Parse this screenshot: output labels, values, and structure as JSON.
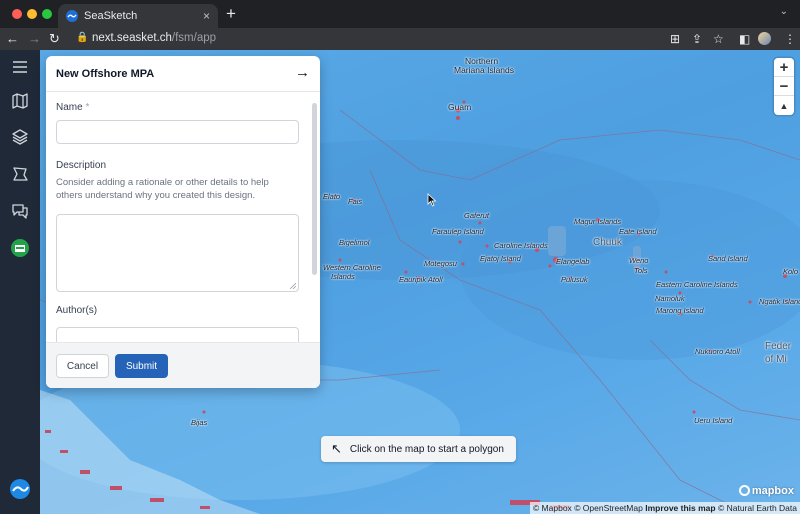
{
  "browser": {
    "tab_title": "SeaSketch",
    "tab_close": "×",
    "new_tab": "+",
    "url_host": "next.seasket.ch",
    "url_path": "/fsm/app"
  },
  "sidebar": {
    "items": [
      {
        "icon": "menu-icon"
      },
      {
        "icon": "map-icon"
      },
      {
        "icon": "layers-icon"
      },
      {
        "icon": "sketch-icon"
      },
      {
        "icon": "discussion-icon"
      },
      {
        "icon": "project-logo-icon"
      }
    ]
  },
  "panel": {
    "title": "New Offshore MPA",
    "name_label": "Name",
    "name_required": "*",
    "description_label": "Description",
    "description_help": "Consider adding a rationale or other details to help others understand why you created this design.",
    "authors_label": "Author(s)",
    "cancel_label": "Cancel",
    "submit_label": "Submit"
  },
  "map": {
    "hint": "Click on the map to start a polygon",
    "zoom_in": "+",
    "zoom_out": "−",
    "compass": "▲",
    "attribution_mapbox": "© Mapbox",
    "attribution_osm": "© OpenStreetMap",
    "attribution_improve": "Improve this map",
    "attribution_ne": "© Natural Earth Data",
    "logo": "mapbox",
    "labels": [
      {
        "text": "Northern",
        "cls": "big"
      },
      {
        "text": "Mariana Islands",
        "cls": "big"
      },
      {
        "text": "Guam",
        "cls": "big"
      },
      {
        "text": "Elato",
        "cls": ""
      },
      {
        "text": "Fais",
        "cls": ""
      },
      {
        "text": "Gaferut",
        "cls": ""
      },
      {
        "text": "Magur Islands",
        "cls": ""
      },
      {
        "text": "Eate Island",
        "cls": ""
      },
      {
        "text": "Faraulep Island",
        "cls": ""
      },
      {
        "text": "Chuuk",
        "cls": "region"
      },
      {
        "text": "Bigelimol",
        "cls": ""
      },
      {
        "text": "Caroline Islands",
        "cls": ""
      },
      {
        "text": "Sand Island",
        "cls": ""
      },
      {
        "text": "Western Caroline",
        "cls": ""
      },
      {
        "text": "Islands",
        "cls": ""
      },
      {
        "text": "Motegosu",
        "cls": ""
      },
      {
        "text": "Ejatoj Island",
        "cls": ""
      },
      {
        "text": "Elangelab",
        "cls": ""
      },
      {
        "text": "Weno",
        "cls": ""
      },
      {
        "text": "Tols",
        "cls": ""
      },
      {
        "text": "Kolo",
        "cls": ""
      },
      {
        "text": "Eauripik Atoll",
        "cls": ""
      },
      {
        "text": "Pulusuk",
        "cls": ""
      },
      {
        "text": "Eastern Caroline Islands",
        "cls": ""
      },
      {
        "text": "Namoluk",
        "cls": ""
      },
      {
        "text": "Marong Island",
        "cls": ""
      },
      {
        "text": "Ngatik Island",
        "cls": ""
      },
      {
        "text": "Nukuoro Atoll",
        "cls": ""
      },
      {
        "text": "Feder",
        "cls": "region"
      },
      {
        "text": "of Mi",
        "cls": "region"
      },
      {
        "text": "Bijas",
        "cls": ""
      },
      {
        "text": "Ueru Island",
        "cls": ""
      }
    ]
  }
}
